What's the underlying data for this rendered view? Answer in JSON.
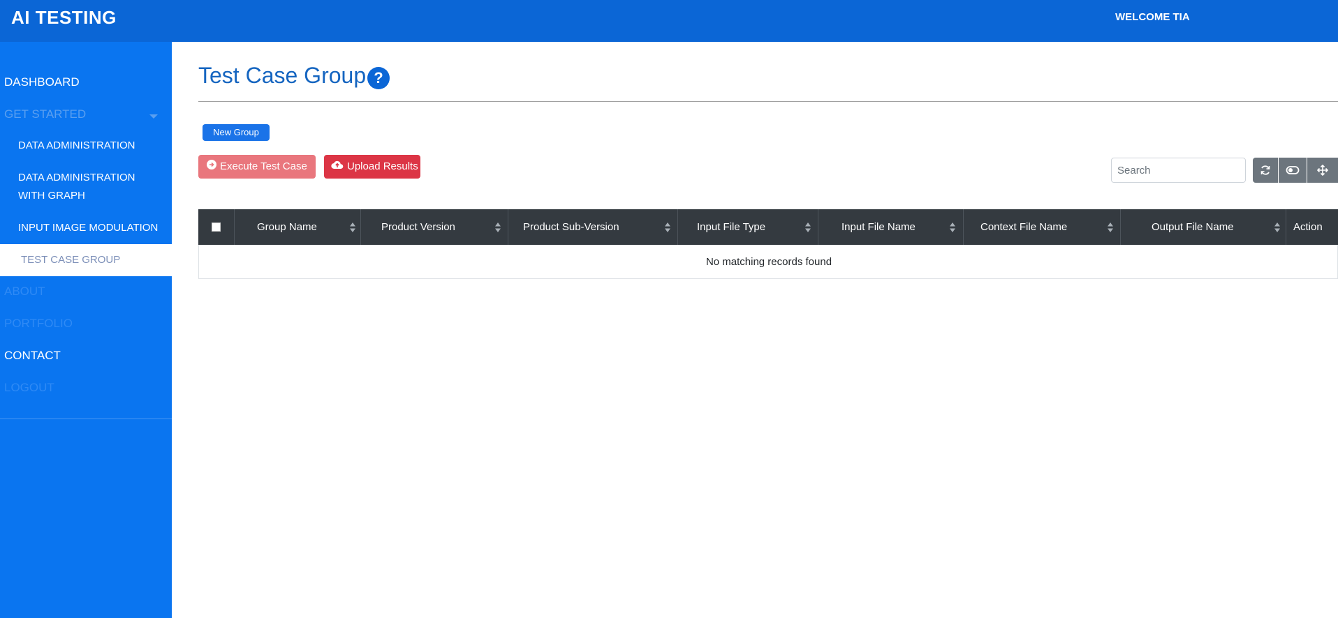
{
  "header": {
    "brand": "AI TESTING",
    "welcome": "WELCOME TIA"
  },
  "sidebar": {
    "items": [
      {
        "label": "DASHBOARD"
      },
      {
        "label": "GET STARTED"
      },
      {
        "label": "DATA ADMINISTRATION"
      },
      {
        "label_line1": "DATA ADMINISTRATION",
        "label_line2": "WITH GRAPH"
      },
      {
        "label": "INPUT IMAGE MODULATION"
      },
      {
        "label": "TEST CASE GROUP"
      },
      {
        "label": "ABOUT"
      },
      {
        "label": "PORTFOLIO"
      },
      {
        "label": "CONTACT"
      },
      {
        "label": "LOGOUT"
      }
    ],
    "active_item": "TEST CASE GROUP"
  },
  "page": {
    "title": "Test Case Group",
    "help_label": "?"
  },
  "toolbar": {
    "new_group_label": "New Group",
    "execute_label": "Execute Test Case",
    "upload_label": "Upload Results",
    "search_placeholder": "Search"
  },
  "table": {
    "columns": [
      "Group Name",
      "Product Version",
      "Product Sub-Version",
      "Input File Type",
      "Input File Name",
      "Context File Name",
      "Output File Name",
      "Action"
    ],
    "empty_message": "No matching records found"
  },
  "colors": {
    "topbar": "#0b66d6",
    "sidebar": "#0a75f0",
    "title": "#1565c0",
    "table_header": "#343a40",
    "execute_button": "#e9767d",
    "upload_button": "#dc3545",
    "toolbar_button": "#6c757d"
  },
  "icons": {
    "help": "question-circle-icon",
    "execute": "arrow-circle-right-icon",
    "upload": "cloud-upload-icon",
    "refresh": "refresh-icon",
    "toggle": "toggle-icon",
    "fullscreen": "arrows-move-icon",
    "sort": "sort-icon",
    "nav_caret": "caret-down-icon"
  }
}
